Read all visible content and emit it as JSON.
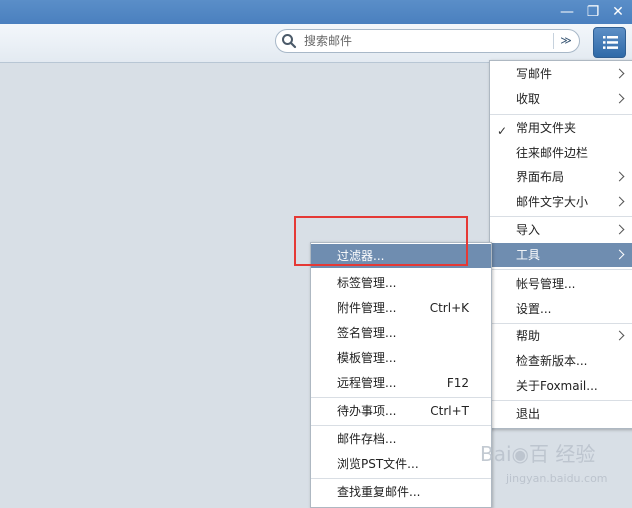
{
  "window": {
    "min_glyph": "—",
    "restore_glyph": "❐",
    "close_glyph": "✕"
  },
  "search": {
    "placeholder": "搜索邮件",
    "dropdown_glyph": "≫"
  },
  "main_menu": {
    "items": [
      {
        "label": "写邮件",
        "submenu": true
      },
      {
        "label": "收取",
        "submenu": true
      },
      {
        "label": "常用文件夹",
        "checked": true
      },
      {
        "label": "往来邮件边栏"
      },
      {
        "label": "界面布局",
        "submenu": true
      },
      {
        "label": "邮件文字大小",
        "submenu": true
      },
      {
        "label": "导入",
        "submenu": true
      },
      {
        "label": "工具",
        "submenu": true,
        "highlighted": true
      },
      {
        "label": "帐号管理..."
      },
      {
        "label": "设置..."
      },
      {
        "label": "帮助",
        "submenu": true
      },
      {
        "label": "检查新版本..."
      },
      {
        "label": "关于Foxmail..."
      },
      {
        "label": "退出"
      }
    ]
  },
  "tools_menu": {
    "items": [
      {
        "label": "过滤器...",
        "highlighted": true
      },
      {
        "label": "标签管理..."
      },
      {
        "label": "附件管理...",
        "shortcut": "Ctrl+K"
      },
      {
        "label": "签名管理..."
      },
      {
        "label": "模板管理..."
      },
      {
        "label": "远程管理...",
        "shortcut": "F12"
      },
      {
        "label": "待办事项...",
        "shortcut": "Ctrl+T"
      },
      {
        "label": "邮件存档..."
      },
      {
        "label": "浏览PST文件..."
      },
      {
        "label": "查找重复邮件..."
      }
    ]
  },
  "watermark": {
    "main": "Bai◉百 经验",
    "sub": "jingyan.baidu.com"
  },
  "colors": {
    "titlebar": "#4a80bf",
    "highlight": "#6f8db0",
    "annotation": "#e53935",
    "background": "#d8dfe6"
  }
}
